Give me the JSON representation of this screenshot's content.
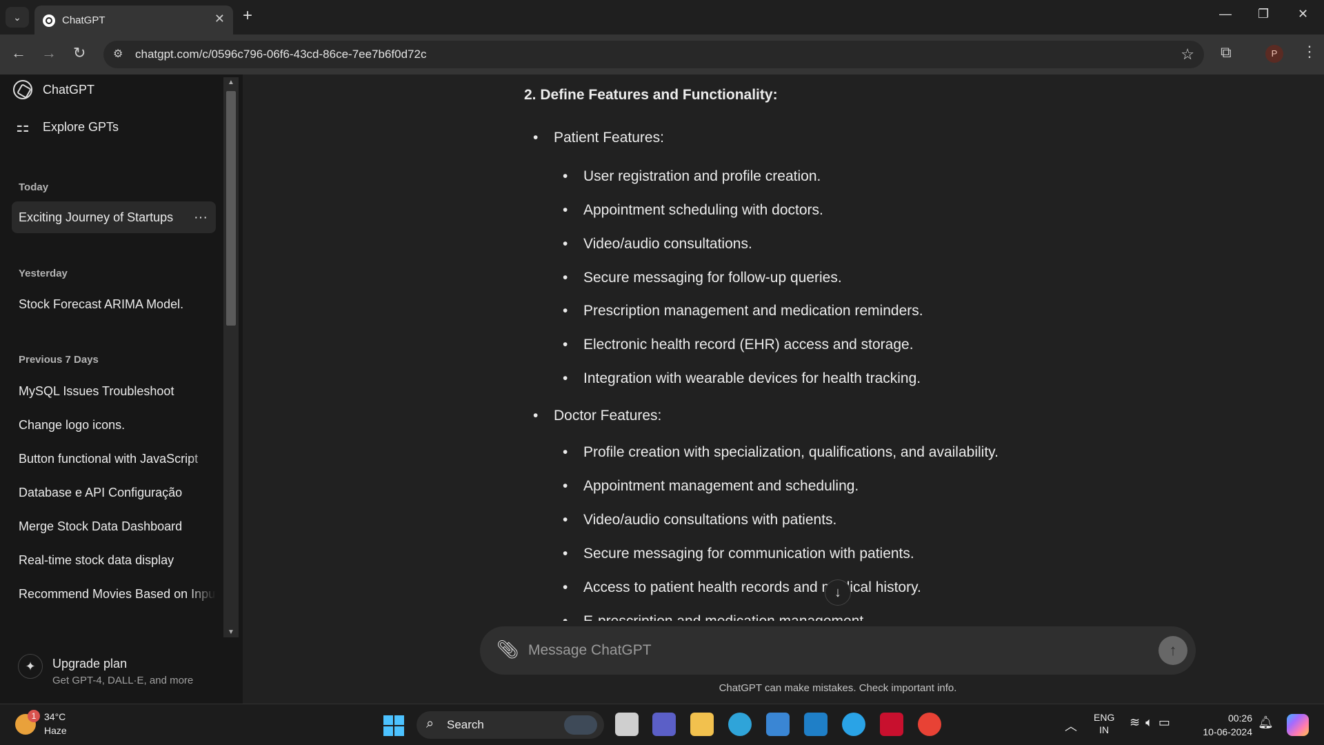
{
  "browser": {
    "tab_title": "ChatGPT",
    "tab_close": "✕",
    "new_tab": "+",
    "url": "chatgpt.com/c/0596c796-06f6-43cd-86ce-7ee7b6f0d72c",
    "profile_initial": "P",
    "window_controls": {
      "minimize": "—",
      "restore": "❐",
      "close": "✕"
    },
    "icons": [
      "tab-list-icon",
      "back-icon",
      "forward-icon",
      "reload-icon",
      "site-info-icon",
      "star-icon",
      "extensions-icon",
      "menu-icon"
    ]
  },
  "sidebar": {
    "top_items": [
      {
        "label": "ChatGPT",
        "icon": "chatgpt-logo-icon"
      },
      {
        "label": "Explore GPTs",
        "icon": "grid-icon"
      }
    ],
    "sections": [
      {
        "title": "Today",
        "items": [
          "Exciting Journey of Startups"
        ]
      },
      {
        "title": "Yesterday",
        "items": [
          "Stock Forecast ARIMA Model."
        ]
      },
      {
        "title": "Previous 7 Days",
        "items": [
          "MySQL Issues Troubleshoot",
          "Change logo icons.",
          "Button functional with JavaScript",
          "Database e API Configuração",
          "Merge Stock Data Dashboard",
          "Real-time stock data display",
          "Recommend Movies Based on Input"
        ]
      }
    ],
    "active_item_menu": "···",
    "upgrade": {
      "title": "Upgrade plan",
      "subtitle": "Get GPT-4, DALL·E, and more"
    }
  },
  "conversation": {
    "heading": "2. Define Features and Functionality:",
    "groups": [
      {
        "title": "Patient Features:",
        "items": [
          "User registration and profile creation.",
          "Appointment scheduling with doctors.",
          "Video/audio consultations.",
          "Secure messaging for follow-up queries.",
          "Prescription management and medication reminders.",
          "Electronic health record (EHR) access and storage.",
          "Integration with wearable devices for health tracking."
        ]
      },
      {
        "title": "Doctor Features:",
        "items": [
          "Profile creation with specialization, qualifications, and availability.",
          "Appointment management and scheduling.",
          "Video/audio consultations with patients.",
          "Secure messaging for communication with patients.",
          "Access to patient health records and medical history.",
          "E-prescription and medication management."
        ]
      }
    ]
  },
  "composer": {
    "placeholder": "Message ChatGPT",
    "disclaimer": "ChatGPT can make mistakes. Check important info."
  },
  "taskbar": {
    "weather_temp": "34°C",
    "weather_desc": "Haze",
    "weather_badge": "1",
    "search_label": "Search",
    "lang_line1": "ENG",
    "lang_line2": "IN",
    "time": "00:26",
    "date": "10-06-2024",
    "apps": [
      {
        "name": "task-view-icon",
        "color": "#cfcfcf"
      },
      {
        "name": "teams-icon",
        "color": "#5b5fc7"
      },
      {
        "name": "file-explorer-icon",
        "color": "#f2c14e"
      },
      {
        "name": "edge-icon",
        "color": "#2fa4d9"
      },
      {
        "name": "store-icon",
        "color": "#3a86d4"
      },
      {
        "name": "mylio-icon",
        "color": "#1f7fc7"
      },
      {
        "name": "tips-icon",
        "color": "#2aa3e6"
      },
      {
        "name": "mcafee-icon",
        "color": "#c8102e"
      },
      {
        "name": "chrome-icon",
        "color": "#e84235"
      }
    ]
  }
}
